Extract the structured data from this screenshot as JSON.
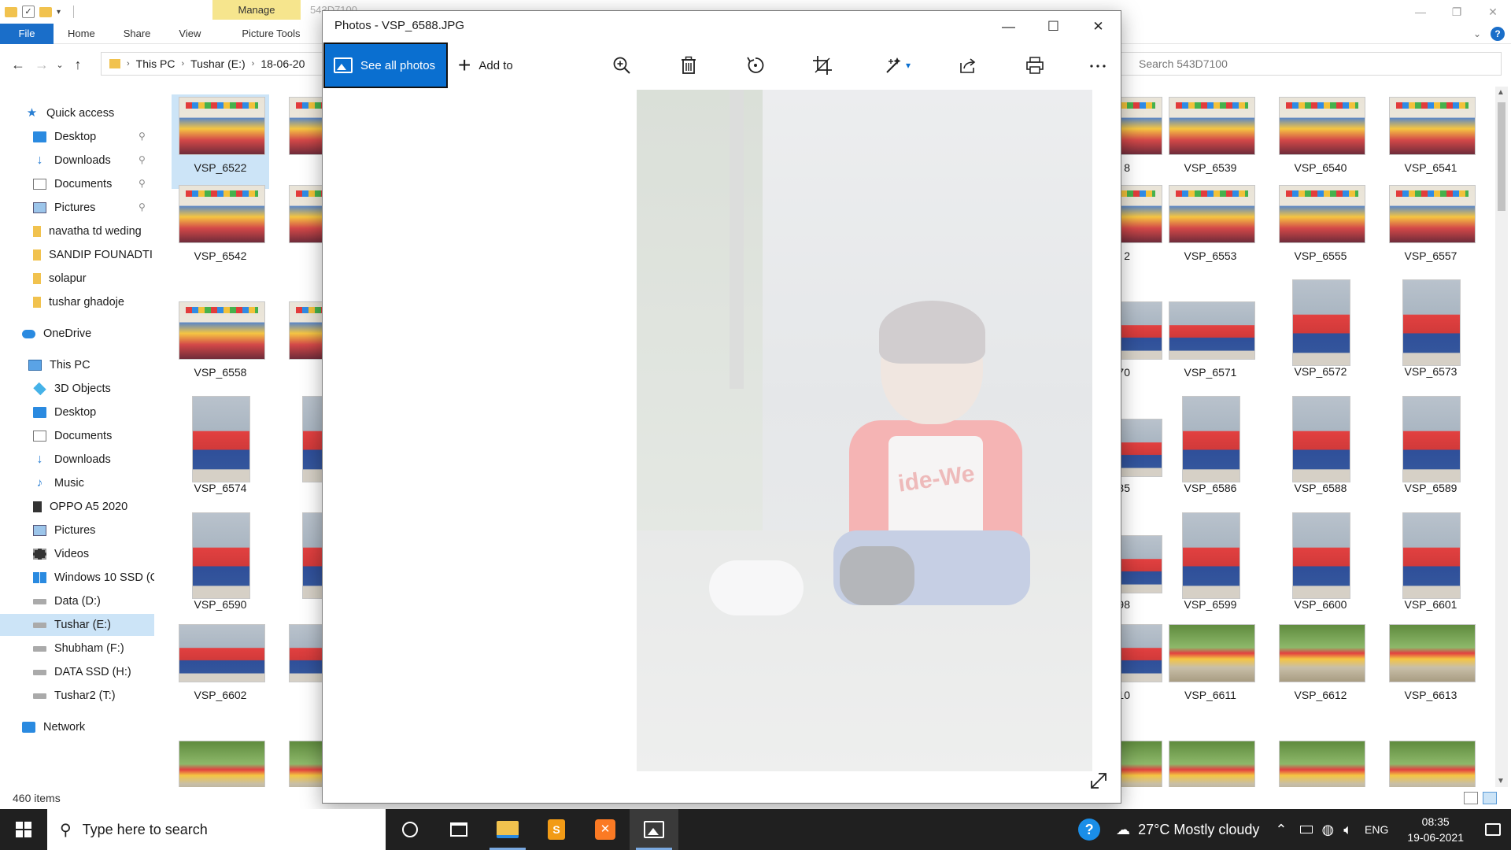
{
  "explorer": {
    "window_title": "543D7100",
    "manage_tab": "Manage",
    "ribbon_tabs": [
      "File",
      "Home",
      "Share",
      "View",
      "Picture Tools"
    ],
    "breadcrumb": [
      "This PC",
      "Tushar (E:)",
      "18-06-20"
    ],
    "search_placeholder": "Search 543D7100",
    "nav": {
      "quick_access": "Quick access",
      "desktop": "Desktop",
      "downloads": "Downloads",
      "documents": "Documents",
      "pictures": "Pictures",
      "folder1": "navatha td weding",
      "folder2": "SANDIP FOUNADTI",
      "folder3": "solapur",
      "folder4": "tushar ghadoje",
      "onedrive": "OneDrive",
      "this_pc": "This PC",
      "objects3d": "3D Objects",
      "desktop2": "Desktop",
      "documents2": "Documents",
      "downloads2": "Downloads",
      "music": "Music",
      "oppo": "OPPO A5 2020",
      "pictures2": "Pictures",
      "videos": "Videos",
      "win10": "Windows 10 SSD (C",
      "data_d": "Data (D:)",
      "tushar_e": "Tushar (E:)",
      "shubham_f": "Shubham (F:)",
      "datassd_h": "DATA SSD (H:)",
      "tushar2_t": "Tushar2 (T:)",
      "network": "Network"
    },
    "files": {
      "c1": [
        "VSP_6522",
        "VSP_6542",
        "VSP_6558",
        "VSP_6574",
        "VSP_6590",
        "VSP_6602"
      ],
      "c2": [
        "VS",
        "VS",
        "VS",
        "VS",
        "VS",
        "VS"
      ],
      "peek": [
        "8",
        "2",
        "70",
        "35",
        "98",
        "10"
      ],
      "c3": [
        "VSP_6539",
        "VSP_6553",
        "VSP_6571",
        "VSP_6586",
        "VSP_6599",
        "VSP_6611"
      ],
      "c4": [
        "VSP_6540",
        "VSP_6555",
        "VSP_6572",
        "VSP_6588",
        "VSP_6600",
        "VSP_6612"
      ],
      "c5": [
        "VSP_6541",
        "VSP_6557",
        "VSP_6573",
        "VSP_6589",
        "VSP_6601",
        "VSP_6613"
      ]
    },
    "status": "460 items"
  },
  "photos": {
    "title": "Photos - VSP_6588.JPG",
    "see_all": "See all photos",
    "add_to": "Add to",
    "tee_text": "ide-We"
  },
  "taskbar": {
    "search_placeholder": "Type here to search",
    "weather": "27°C  Mostly cloudy",
    "lang": "ENG",
    "time": "08:35",
    "date": "19-06-2021"
  }
}
